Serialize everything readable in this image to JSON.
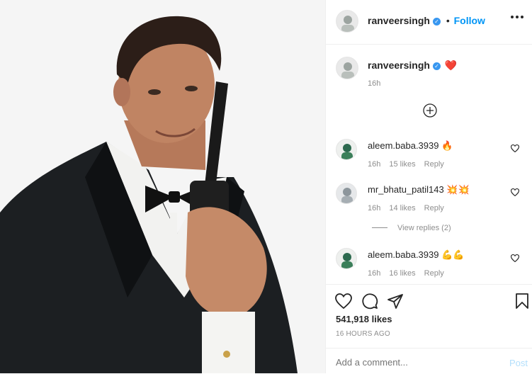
{
  "post": {
    "username": "ranveersingh",
    "follow_label": "Follow",
    "separator": "•"
  },
  "caption": {
    "username": "ranveersingh",
    "text": "❤️",
    "time": "16h"
  },
  "comments": [
    {
      "username": "aleem.baba.3939",
      "text": "🔥",
      "time": "16h",
      "likes": "15 likes",
      "reply": "Reply"
    },
    {
      "username": "mr_bhatu_patil143",
      "text": "💥💥",
      "time": "16h",
      "likes": "14 likes",
      "reply": "Reply",
      "view_replies": "View replies (2)"
    },
    {
      "username": "aleem.baba.3939",
      "text": "💪💪",
      "time": "16h",
      "likes": "16 likes",
      "reply": "Reply"
    }
  ],
  "stats": {
    "likes": "541,918 likes",
    "time_ago": "16 HOURS AGO"
  },
  "composer": {
    "placeholder": "Add a comment...",
    "post_label": "Post"
  },
  "icons": {
    "like": "heart-outline-icon",
    "comment": "comment-bubble-icon",
    "share": "paper-plane-icon",
    "save": "bookmark-icon",
    "more": "more-options-icon",
    "load_more": "plus-circle-icon"
  }
}
